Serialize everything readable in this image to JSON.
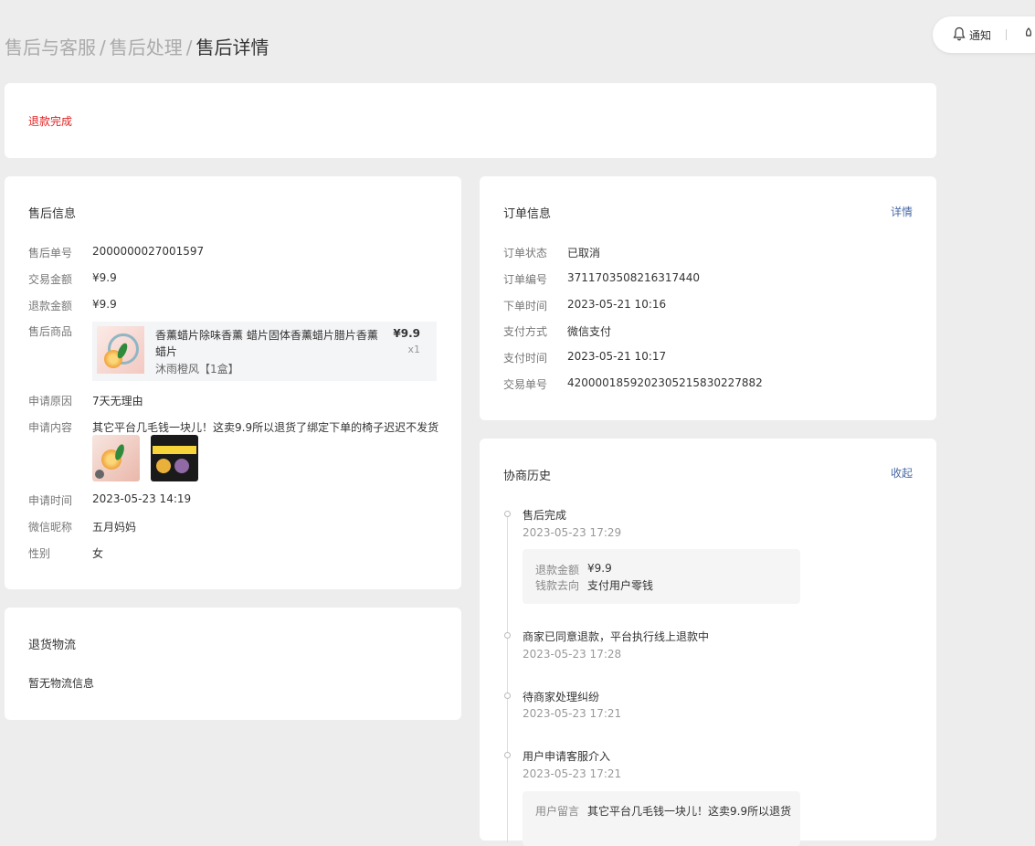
{
  "breadcrumb": {
    "level1": "售后与客服",
    "level2": "售后处理",
    "current": "售后详情",
    "separator": "/"
  },
  "topbar": {
    "notify_label": "通知",
    "bell_icon": "bell-icon",
    "rocket_icon": "rocket-icon"
  },
  "status": {
    "text": "退款完成",
    "color": "#e02020"
  },
  "after_sale": {
    "title": "售后信息",
    "labels": {
      "order_no": "售后单号",
      "trade_amount": "交易金额",
      "refund_amount": "退款金额",
      "product": "售后商品",
      "reason": "申请原因",
      "content": "申请内容",
      "apply_time": "申请时间",
      "nickname": "微信昵称",
      "gender": "性别"
    },
    "order_no": "2000000027001597",
    "trade_amount": "¥9.9",
    "refund_amount": "¥9.9",
    "product": {
      "name": "香薰蜡片除味香薰 蜡片固体香薰蜡片腊片香薰 蜡片",
      "spec": "沐雨橙风【1盒】",
      "price": "¥9.9",
      "qty": "x1"
    },
    "reason": "7天无理由",
    "content": "其它平台几毛钱一块儿！这卖9.9所以退货了绑定下单的椅子迟迟不发货",
    "apply_time": "2023-05-23 14:19",
    "nickname": "五月妈妈",
    "gender": "女"
  },
  "order": {
    "title": "订单信息",
    "detail_link": "详情",
    "labels": {
      "status": "订单状态",
      "order_no": "订单编号",
      "order_time": "下单时间",
      "pay_method": "支付方式",
      "pay_time": "支付时间",
      "trade_no": "交易单号"
    },
    "status": "已取消",
    "order_no": "3711703508216317440",
    "order_time": "2023-05-21 10:16",
    "pay_method": "微信支付",
    "pay_time": "2023-05-21 10:17",
    "trade_no": "4200001859202305215830227882"
  },
  "logistics": {
    "title": "退货物流",
    "empty": "暂无物流信息"
  },
  "history": {
    "title": "协商历史",
    "collapse_link": "收起",
    "items": [
      {
        "title": "售后完成",
        "time": "2023-05-23 17:29",
        "details": [
          {
            "k": "退款金额",
            "v": "¥9.9"
          },
          {
            "k": "钱款去向",
            "v": "支付用户零钱"
          }
        ]
      },
      {
        "title": "商家已同意退款，平台执行线上退款中",
        "time": "2023-05-23 17:28"
      },
      {
        "title": "待商家处理纠纷",
        "time": "2023-05-23 17:21"
      },
      {
        "title": "用户申请客服介入",
        "time": "2023-05-23 17:21",
        "details": [
          {
            "k": "用户留言",
            "v": "其它平台几毛钱一块儿！这卖9.9所以退货"
          }
        ]
      }
    ]
  }
}
